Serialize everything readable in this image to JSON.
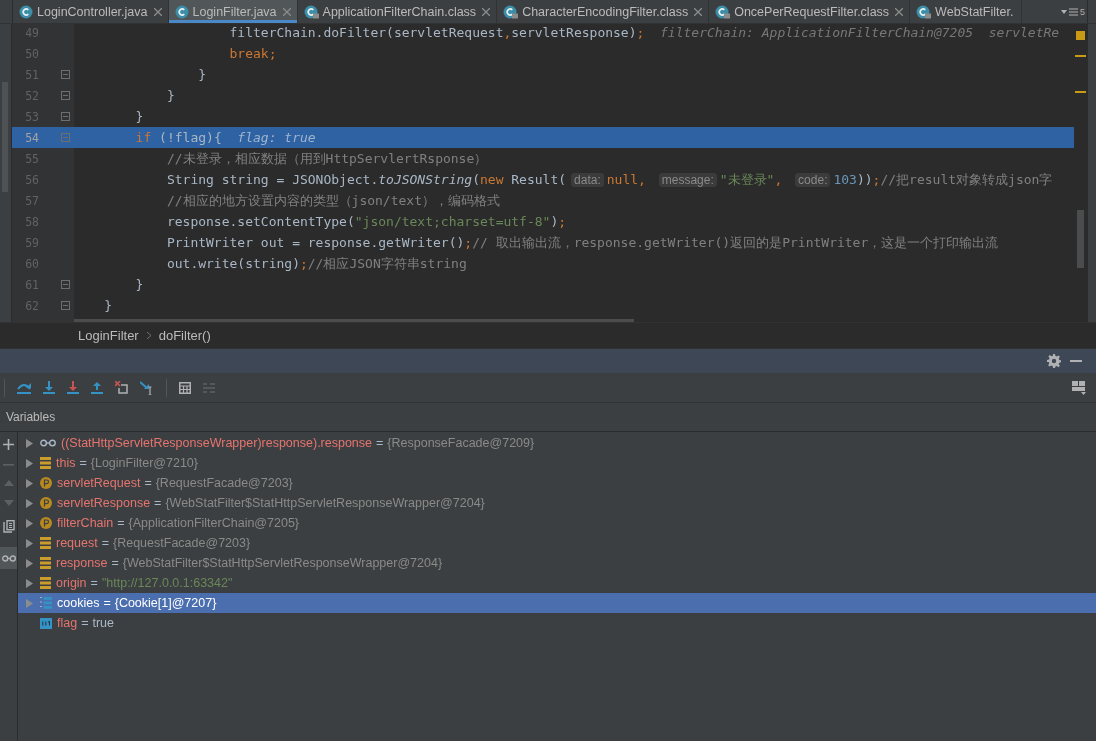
{
  "tabs": [
    {
      "label": "LoginController.java",
      "kind": "java",
      "selected": false,
      "close": true
    },
    {
      "label": "LoginFilter.java",
      "kind": "java",
      "selected": true,
      "close": true
    },
    {
      "label": "ApplicationFilterChain.class",
      "kind": "class",
      "selected": false,
      "close": true
    },
    {
      "label": "CharacterEncodingFilter.class",
      "kind": "class",
      "selected": false,
      "close": true
    },
    {
      "label": "OncePerRequestFilter.class",
      "kind": "class",
      "selected": false,
      "close": true
    },
    {
      "label": "WebStatFilter.",
      "kind": "class",
      "selected": false,
      "close": false
    }
  ],
  "tab_overflow": {
    "count": "5"
  },
  "editor": {
    "lines": [
      {
        "number": "49",
        "fold": false,
        "highlighted": false,
        "tokens": [
          {
            "kind": "plain",
            "text": "                    filterChain.doFilter(servletRequest"
          },
          {
            "kind": "op",
            "text": ","
          },
          {
            "kind": "plain",
            "text": "servletResponse)"
          },
          {
            "kind": "op",
            "text": ";"
          },
          {
            "kind": "value",
            "text": "  filterChain: ApplicationFilterChain@7205  servletRe"
          }
        ]
      },
      {
        "number": "50",
        "fold": false,
        "highlighted": false,
        "tokens": [
          {
            "kind": "keyword",
            "text": "                    break;"
          }
        ]
      },
      {
        "number": "51",
        "fold": true,
        "highlighted": false,
        "tokens": [
          {
            "kind": "plain",
            "text": "                }"
          }
        ]
      },
      {
        "number": "52",
        "fold": true,
        "highlighted": false,
        "tokens": [
          {
            "kind": "plain",
            "text": "            }"
          }
        ]
      },
      {
        "number": "53",
        "fold": true,
        "highlighted": false,
        "tokens": [
          {
            "kind": "plain",
            "text": "        }"
          }
        ]
      },
      {
        "number": "54",
        "fold": true,
        "highlighted": true,
        "tokens": [
          {
            "kind": "keyword",
            "text": "        if "
          },
          {
            "kind": "plain",
            "text": "(!flag){"
          },
          {
            "kind": "value",
            "text": "  flag: true"
          }
        ]
      },
      {
        "number": "55",
        "fold": false,
        "highlighted": false,
        "tokens": [
          {
            "kind": "comment",
            "text": "            //未登录，相应数据（用到HttpServlertRsponse）"
          }
        ]
      },
      {
        "number": "56",
        "fold": false,
        "highlighted": false,
        "tokens": [
          {
            "kind": "plain",
            "text": "            String string = JSONObject."
          },
          {
            "kind": "method",
            "text": "toJSONString"
          },
          {
            "kind": "plain",
            "text": "("
          },
          {
            "kind": "keyword",
            "text": "new "
          },
          {
            "kind": "plain",
            "text": "Result("
          },
          {
            "kind": "hint",
            "text": "data:"
          },
          {
            "kind": "keyword",
            "text": "null"
          },
          {
            "kind": "op",
            "text": ", "
          },
          {
            "kind": "hint",
            "text": "message:"
          },
          {
            "kind": "string",
            "text": "\"未登录\""
          },
          {
            "kind": "op",
            "text": ", "
          },
          {
            "kind": "hint",
            "text": "code:"
          },
          {
            "kind": "number",
            "text": "103"
          },
          {
            "kind": "plain",
            "text": "))"
          },
          {
            "kind": "op",
            "text": ";"
          },
          {
            "kind": "comment",
            "text": "//把result对象转成json字"
          }
        ]
      },
      {
        "number": "57",
        "fold": false,
        "highlighted": false,
        "tokens": [
          {
            "kind": "comment",
            "text": "            //相应的地方设置内容的类型（json/text），编码格式"
          }
        ]
      },
      {
        "number": "58",
        "fold": false,
        "highlighted": false,
        "tokens": [
          {
            "kind": "plain",
            "text": "            response.setContentType("
          },
          {
            "kind": "string",
            "text": "\"json/text;charset=utf-8\""
          },
          {
            "kind": "plain",
            "text": ")"
          },
          {
            "kind": "op",
            "text": ";"
          }
        ]
      },
      {
        "number": "59",
        "fold": false,
        "highlighted": false,
        "tokens": [
          {
            "kind": "plain",
            "text": "            PrintWriter out = response.getWriter()"
          },
          {
            "kind": "op",
            "text": ";"
          },
          {
            "kind": "comment",
            "text": "// 取出输出流，response.getWriter()返回的是PrintWriter，这是一个打印输出流"
          }
        ]
      },
      {
        "number": "60",
        "fold": false,
        "highlighted": false,
        "tokens": [
          {
            "kind": "plain",
            "text": "            out.write(string)"
          },
          {
            "kind": "op",
            "text": ";"
          },
          {
            "kind": "comment",
            "text": "//相应JSON字符串string"
          }
        ]
      },
      {
        "number": "61",
        "fold": true,
        "highlighted": false,
        "tokens": [
          {
            "kind": "plain",
            "text": "        }"
          }
        ]
      },
      {
        "number": "62",
        "fold": true,
        "highlighted": false,
        "tokens": [
          {
            "kind": "plain",
            "text": "    }"
          }
        ]
      }
    ]
  },
  "breadcrumb": [
    "LoginFilter",
    "doFilter()"
  ],
  "variables": {
    "title": "Variables",
    "rows": [
      {
        "kind": "watch",
        "name": "((StatHttpServletResponseWrapper)response).response",
        "operator": "=",
        "value": {
          "kind": "object",
          "text": "{ResponseFacade@7209}"
        },
        "expandable": true,
        "selected": false
      },
      {
        "kind": "field",
        "name": "this",
        "operator": "=",
        "value": {
          "kind": "object",
          "text": "{LoginFilter@7210}"
        },
        "expandable": true,
        "selected": false
      },
      {
        "kind": "param",
        "name": "servletRequest",
        "operator": "=",
        "value": {
          "kind": "object",
          "text": "{RequestFacade@7203}"
        },
        "expandable": true,
        "selected": false
      },
      {
        "kind": "param",
        "name": "servletResponse",
        "operator": "=",
        "value": {
          "kind": "object",
          "text": "{WebStatFilter$StatHttpServletResponseWrapper@7204}"
        },
        "expandable": true,
        "selected": false
      },
      {
        "kind": "param",
        "name": "filterChain",
        "operator": "=",
        "value": {
          "kind": "object",
          "text": "{ApplicationFilterChain@7205}"
        },
        "expandable": true,
        "selected": false
      },
      {
        "kind": "field",
        "name": "request",
        "operator": "=",
        "value": {
          "kind": "object",
          "text": "{RequestFacade@7203}"
        },
        "expandable": true,
        "selected": false
      },
      {
        "kind": "field",
        "name": "response",
        "operator": "=",
        "value": {
          "kind": "object",
          "text": "{WebStatFilter$StatHttpServletResponseWrapper@7204}"
        },
        "expandable": true,
        "selected": false
      },
      {
        "kind": "field",
        "name": "origin",
        "operator": "=",
        "value": {
          "kind": "string",
          "text": "\"http://127.0.0.1:63342\""
        },
        "expandable": true,
        "selected": false
      },
      {
        "kind": "array",
        "name": "cookies",
        "operator": "=",
        "value": {
          "kind": "object",
          "text": "{Cookie[1]@7207}"
        },
        "expandable": true,
        "selected": true
      },
      {
        "kind": "primitive",
        "name": "flag",
        "operator": "=",
        "value": {
          "kind": "plain",
          "text": "true"
        },
        "expandable": false,
        "selected": false
      }
    ]
  }
}
